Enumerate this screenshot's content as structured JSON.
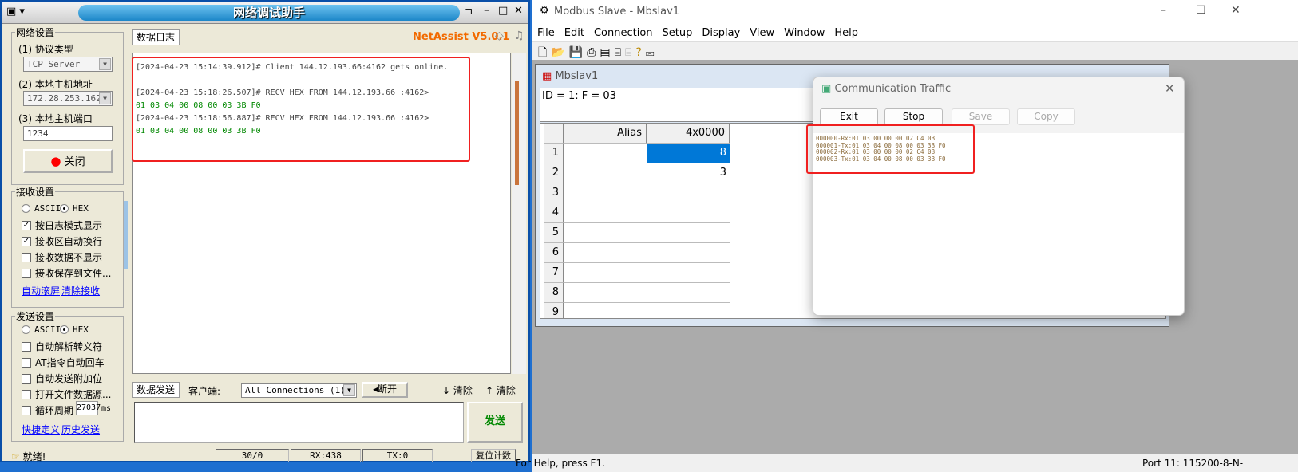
{
  "netassist": {
    "title": "网络调试助手",
    "tab_log": "数据日志",
    "version": "NetAssist V5.0.1",
    "net_settings": {
      "legend": "网络设置",
      "protocol_label": "(1) 协议类型",
      "protocol_value": "TCP Server",
      "host_label": "(2) 本地主机地址",
      "host_value": "172.28.253.162",
      "port_label": "(3) 本地主机端口",
      "port_value": "1234",
      "close_button": "关闭"
    },
    "recv_settings": {
      "legend": "接收设置",
      "ascii": "ASCII",
      "hex": "HEX",
      "options": [
        {
          "label": "按日志模式显示",
          "checked": true
        },
        {
          "label": "接收区自动换行",
          "checked": true
        },
        {
          "label": "接收数据不显示",
          "checked": false
        },
        {
          "label": "接收保存到文件...",
          "checked": false
        }
      ],
      "link_autoscroll": "自动滚屏",
      "link_clear": "清除接收"
    },
    "send_settings": {
      "legend": "发送设置",
      "ascii": "ASCII",
      "hex": "HEX",
      "options": [
        {
          "label": "自动解析转义符",
          "checked": false
        },
        {
          "label": "AT指令自动回车",
          "checked": false
        },
        {
          "label": "自动发送附加位",
          "checked": false
        },
        {
          "label": "打开文件数据源...",
          "checked": false
        },
        {
          "label": "循环周期",
          "checked": false
        }
      ],
      "cycle_value": "27037",
      "cycle_unit": "ms",
      "link_shortcut": "快捷定义",
      "link_history": "历史发送"
    },
    "log": [
      {
        "header": "[2024-04-23 15:14:39.912]# Client 144.12.193.66:4162 gets online.",
        "data": ""
      },
      {
        "header": "[2024-04-23 15:18:26.507]# RECV HEX FROM 144.12.193.66 :4162>",
        "data": "01 03 04 00 08 00 03 3B F0"
      },
      {
        "header": "[2024-04-23 15:18:56.887]# RECV HEX FROM 144.12.193.66 :4162>",
        "data": "01 03 04 00 08 00 03 3B F0"
      }
    ],
    "send_bar": {
      "tab": "数据发送",
      "client_label": "客户端:",
      "client_value": "All Connections (1)",
      "disconnect": "断开",
      "clear1": "清除",
      "clear2": "清除"
    },
    "send_button": "发送",
    "status": {
      "text": "就绪!",
      "count": "30/0",
      "rx": "RX:438",
      "tx": "TX:0",
      "reset": "复位计数"
    }
  },
  "modbus": {
    "title": "Modbus Slave - Mbslav1",
    "menu": [
      "File",
      "Edit",
      "Connection",
      "Setup",
      "Display",
      "View",
      "Window",
      "Help"
    ],
    "child": {
      "title": "Mbslav1",
      "id_line": "ID = 1: F = 03",
      "col_alias": "Alias",
      "col_reg": "4x0000",
      "rows": [
        {
          "n": "1",
          "v": "8"
        },
        {
          "n": "2",
          "v": "3"
        },
        {
          "n": "3",
          "v": ""
        },
        {
          "n": "4",
          "v": ""
        },
        {
          "n": "5",
          "v": ""
        },
        {
          "n": "6",
          "v": ""
        },
        {
          "n": "7",
          "v": ""
        },
        {
          "n": "8",
          "v": ""
        },
        {
          "n": "9",
          "v": ""
        }
      ]
    },
    "traffic": {
      "title": "Communication Traffic",
      "exit": "Exit",
      "stop": "Stop",
      "save": "Save",
      "copy": "Copy",
      "lines": [
        "000000-Rx:01 03 00 00 00 02 C4 0B",
        "000001-Tx:01 03 04 00 08 00 03 3B F0",
        "000002-Rx:01 03 00 00 00 02 C4 0B",
        "000003-Tx:01 03 04 00 08 00 03 3B F0"
      ]
    },
    "status_help": "For Help, press F1.",
    "status_port": "Port 11: 115200-8-N-"
  }
}
